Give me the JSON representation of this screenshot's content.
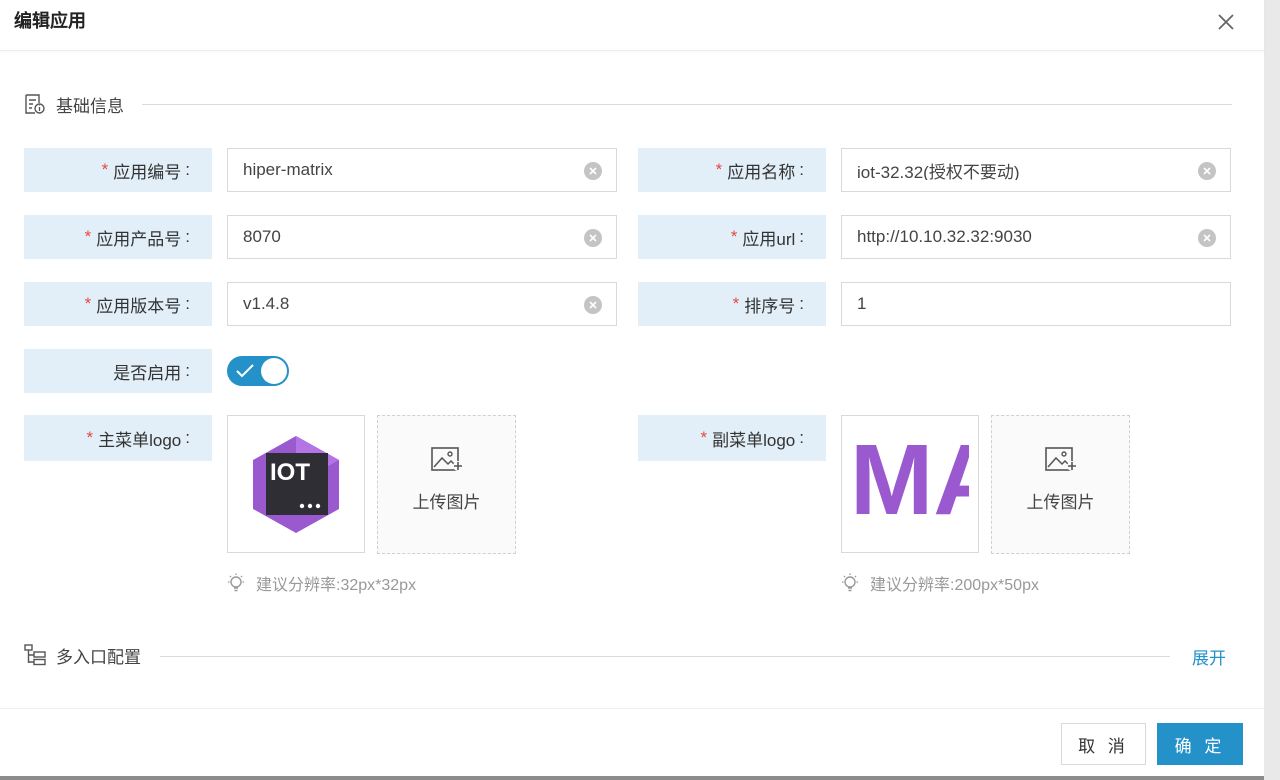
{
  "dialog": {
    "title": "编辑应用",
    "close_icon": "close-icon"
  },
  "basic_section": {
    "title": "基础信息",
    "icon": "document-info-icon"
  },
  "form": {
    "app_code": {
      "label": "应用编号",
      "required": true,
      "value": "hiper-matrix"
    },
    "app_name": {
      "label": "应用名称",
      "required": true,
      "value": "iot-32.32(授权不要动)"
    },
    "product_no": {
      "label": "应用产品号",
      "required": true,
      "value": "8070"
    },
    "app_url": {
      "label": "应用url",
      "required": true,
      "value": "http://10.10.32.32:9030"
    },
    "version": {
      "label": "应用版本号",
      "required": true,
      "value": "v1.4.8"
    },
    "sort_no": {
      "label": "排序号",
      "required": true,
      "value": "1"
    },
    "enabled": {
      "label": "是否启用",
      "required": false,
      "value": true
    },
    "main_logo": {
      "label": "主菜单logo",
      "required": true,
      "logo_text": "IOT",
      "upload_label": "上传图片",
      "hint": "建议分辨率:32px*32px"
    },
    "sub_logo": {
      "label": "副菜单logo",
      "required": true,
      "logo_text": "MA",
      "upload_label": "上传图片",
      "hint": "建议分辨率:200px*50px"
    }
  },
  "required_mark": "*",
  "colon": ":",
  "multi_entry_section": {
    "title": "多入口配置",
    "icon": "tree-structure-icon",
    "expand_label": "展开"
  },
  "footer": {
    "cancel_label": "取 消",
    "ok_label": "确 定"
  },
  "colors": {
    "accent": "#2491c9",
    "label_bg": "#e2eff8",
    "required": "#e8473f",
    "logo_purple": "#9b59d0"
  }
}
